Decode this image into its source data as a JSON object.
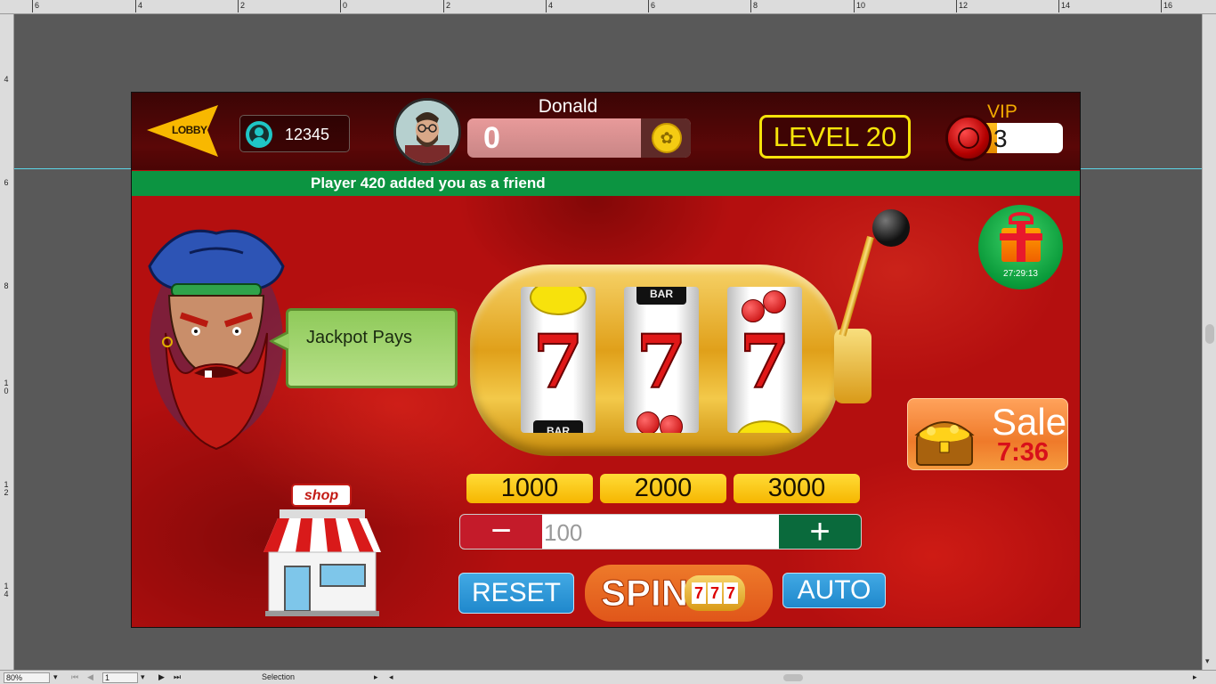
{
  "editor": {
    "ruler_top": [
      "6",
      "4",
      "2",
      "0",
      "2",
      "4",
      "6",
      "8",
      "10",
      "12",
      "14",
      "16"
    ],
    "ruler_left": [
      "4",
      "6",
      "8",
      "1\n0",
      "1\n2",
      "1\n4"
    ],
    "zoom": "80%",
    "page": "1",
    "tool": "Selection"
  },
  "game": {
    "lobby_label": "LOBBY",
    "player_id": "12345",
    "username": "Donald",
    "balance": "0",
    "level": "LEVEL 20",
    "vip_label": "VIP",
    "vip_level": "3",
    "vip_progress": 0.3,
    "notification": "Player 420 added you as a friend",
    "speech": "Jackpot Pays",
    "gift_timer": "27:29:13",
    "sale_title": "Sale",
    "sale_timer": "7:36",
    "shop_label": "shop",
    "reels": [
      {
        "top": "lemon",
        "middle": "7",
        "bottom": "BAR"
      },
      {
        "top": "BAR",
        "middle": "7",
        "bottom": "cherry"
      },
      {
        "top": "cherry",
        "middle": "7",
        "bottom": "lemon"
      }
    ],
    "reel_bar_text": "BAR",
    "bet_options": [
      "1000",
      "2000",
      "3000"
    ],
    "bet_amount": "100",
    "minus_label": "−",
    "plus_label": "+",
    "reset_label": "RESET",
    "spin_label": "SPIN",
    "auto_label": "AUTO",
    "spin_mini_symbol": "7"
  },
  "colors": {
    "background": "#b40f0f",
    "notify_bar": "#0c9441",
    "level_text": "#f6e40a",
    "bet_button": "#ffdc37",
    "minus_button": "#c41b2a",
    "plus_button": "#0a6a3c",
    "blue_button": "#2b97d8",
    "spin_button": "#e8661e"
  }
}
